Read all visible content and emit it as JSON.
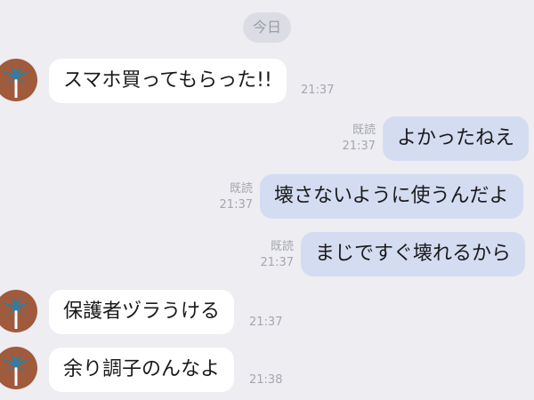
{
  "date_label": "今日",
  "colors": {
    "background": "#ededf2",
    "incoming_bubble": "#ffffff",
    "outgoing_bubble": "#d4dcf2",
    "avatar_bg": "#a05a3c",
    "avatar_tree": "#2a7fa8"
  },
  "contact": {
    "avatar_icon": "palm-tree-icon"
  },
  "messages": [
    {
      "direction": "in",
      "text": "スマホ買ってもらった!!",
      "time": "21:37"
    },
    {
      "direction": "out",
      "text": "よかったねえ",
      "read": "既読",
      "time": "21:37"
    },
    {
      "direction": "out",
      "text": "壊さないように使うんだよ",
      "read": "既読",
      "time": "21:37"
    },
    {
      "direction": "out",
      "text": "まじですぐ壊れるから",
      "read": "既読",
      "time": "21:37"
    },
    {
      "direction": "in",
      "text": "保護者ヅラうける",
      "time": "21:37"
    },
    {
      "direction": "in",
      "text": "余り調子のんなよ",
      "time": "21:38"
    }
  ]
}
